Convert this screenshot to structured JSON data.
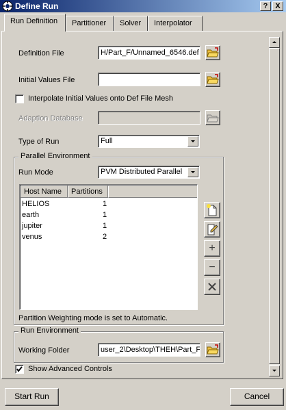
{
  "window": {
    "title": "Define Run",
    "help_glyph": "?",
    "close_glyph": "X"
  },
  "tabs": [
    {
      "label": "Run Definition",
      "active": true
    },
    {
      "label": "Partitioner",
      "active": false
    },
    {
      "label": "Solver",
      "active": false
    },
    {
      "label": "Interpolator",
      "active": false
    }
  ],
  "run_definition": {
    "definition_file_label": "Definition File",
    "definition_file_value": "H/Part_F/Unnamed_6546.def",
    "initial_values_label": "Initial Values File",
    "initial_values_value": "",
    "interpolate_label": "Interpolate Initial Values onto Def File Mesh",
    "interpolate_checked": false,
    "adaption_label": "Adaption Database",
    "adaption_value": "",
    "type_of_run_label": "Type of Run",
    "type_of_run_value": "Full"
  },
  "parallel": {
    "group_title": "Parallel Environment",
    "run_mode_label": "Run Mode",
    "run_mode_value": "PVM Distributed Parallel",
    "columns": [
      "Host Name",
      "Partitions"
    ],
    "hosts": [
      {
        "name": "HELIOS",
        "partitions": "1"
      },
      {
        "name": "earth",
        "partitions": "1"
      },
      {
        "name": "jupiter",
        "partitions": "1"
      },
      {
        "name": "venus",
        "partitions": "2"
      }
    ],
    "weighting_note": "Partition Weighting mode is set to Automatic."
  },
  "run_environment": {
    "group_title": "Run Environment",
    "working_folder_label": "Working Folder",
    "working_folder_value": "user_2\\Desktop\\THEH\\Part_F"
  },
  "show_advanced_label": "Show Advanced Controls",
  "show_advanced_checked": true,
  "buttons": {
    "start_run": "Start Run",
    "cancel": "Cancel"
  },
  "colors": {
    "titlebar_start": "#0a246a",
    "titlebar_end": "#a6caf0",
    "face": "#d4d0c8",
    "folder": "#f0c040"
  }
}
